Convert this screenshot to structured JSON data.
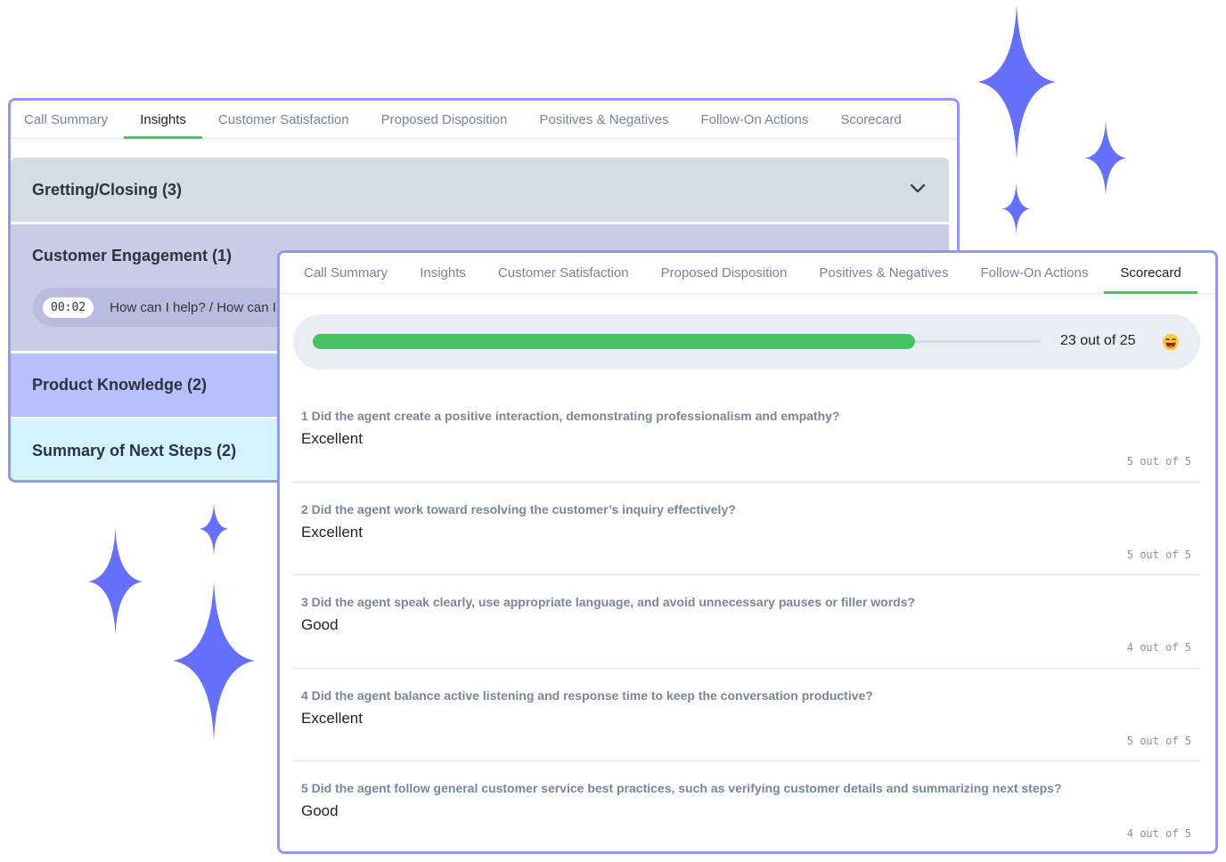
{
  "colors": {
    "accent": "#6670ff",
    "active_tab_underline": "#4cc465",
    "progress_fill": "#45c464",
    "panel_border": "#8f98f2"
  },
  "back_panel": {
    "tabs": [
      {
        "label": "Call Summary",
        "active": false
      },
      {
        "label": "Insights",
        "active": true
      },
      {
        "label": "Customer Satisfaction",
        "active": false
      },
      {
        "label": "Proposed Disposition",
        "active": false
      },
      {
        "label": "Positives & Negatives",
        "active": false
      },
      {
        "label": "Follow-On Actions",
        "active": false
      },
      {
        "label": "Scorecard",
        "active": false
      }
    ],
    "sections": {
      "greeting": "Gretting/Closing (3)",
      "engagement": "Customer Engagement (1)",
      "product": "Product Knowledge (2)",
      "summary": "Summary of Next Steps (2)"
    },
    "transcript": {
      "timestamp": "00:02",
      "text": "How can I help?   /   How can I help you today?"
    }
  },
  "front_panel": {
    "tabs": [
      {
        "label": "Call Summary",
        "active": false
      },
      {
        "label": "Insights",
        "active": false
      },
      {
        "label": "Customer Satisfaction",
        "active": false
      },
      {
        "label": "Proposed Disposition",
        "active": false
      },
      {
        "label": "Positives & Negatives",
        "active": false
      },
      {
        "label": "Follow-On Actions",
        "active": false
      },
      {
        "label": "Scorecard",
        "active": true
      }
    ],
    "score": {
      "text": "23 out of 25",
      "value": 23,
      "max": 25,
      "emoji": "grinning-face-icon"
    },
    "questions": [
      {
        "text": "1 Did the agent create a positive interaction, demonstrating professionalism and empathy?",
        "answer": "Excellent",
        "score": "5 out of 5"
      },
      {
        "text": "2 Did the agent work toward resolving the customer’s inquiry effectively?",
        "answer": "Excellent",
        "score": "5 out of 5"
      },
      {
        "text": "3 Did the agent speak clearly, use appropriate language, and avoid unnecessary pauses or filler words?",
        "answer": "Good",
        "score": "4 out of 5"
      },
      {
        "text": "4 Did the agent balance active listening and response time to keep the conversation productive?",
        "answer": "Excellent",
        "score": "5 out of 5"
      },
      {
        "text": "5 Did the agent follow general customer service best practices, such as verifying customer details and summarizing next steps?",
        "answer": "Good",
        "score": "4 out of 5"
      }
    ]
  }
}
